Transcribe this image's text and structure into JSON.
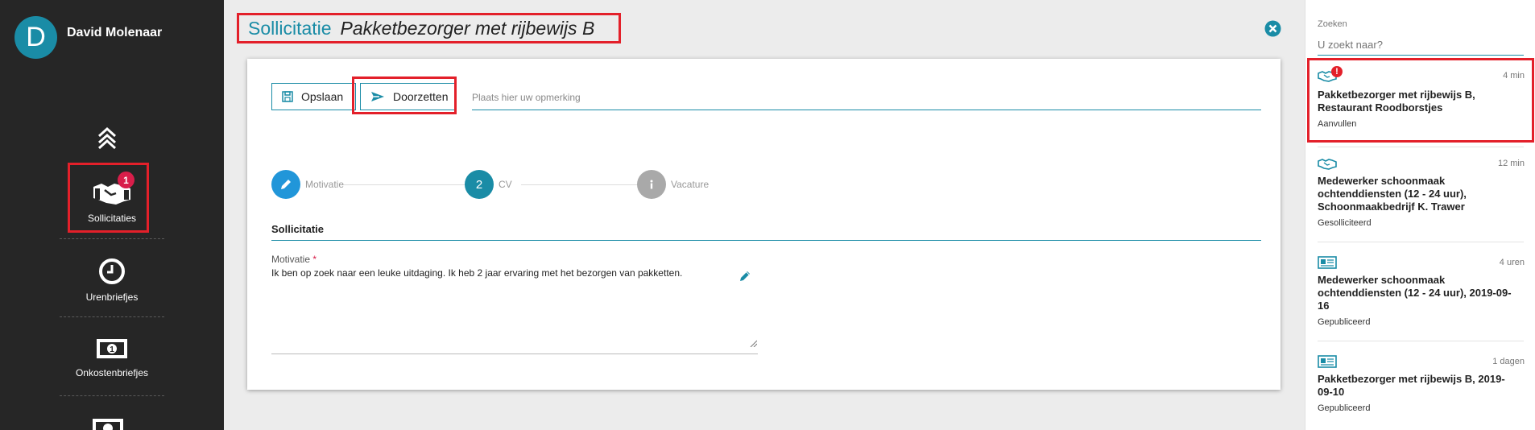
{
  "user": {
    "initial": "D",
    "name": "David Molenaar"
  },
  "nav": {
    "items": [
      {
        "label": "Sollicitaties",
        "badge": "1",
        "icon": "handshake-icon"
      },
      {
        "label": "Urenbriefjes",
        "icon": "clock-icon"
      },
      {
        "label": "Onkostenbriefjes",
        "icon": "money-icon"
      }
    ]
  },
  "header": {
    "title": "Sollicitatie",
    "subtitle": "Pakketbezorger met rijbewijs B"
  },
  "toolbar": {
    "save_label": "Opslaan",
    "forward_label": "Doorzetten",
    "remark_placeholder": "Plaats hier uw opmerking"
  },
  "steps": [
    {
      "label": "Motivatie",
      "icon": "pencil-icon"
    },
    {
      "label": "CV",
      "number": "2"
    },
    {
      "label": "Vacature",
      "icon": "info-icon"
    }
  ],
  "section": {
    "title": "Sollicitatie",
    "field_label": "Motivatie",
    "required_mark": "*",
    "motivation_text": "Ik ben op zoek naar een leuke uitdaging. Ik heb 2 jaar ervaring met het bezorgen van pakketten."
  },
  "search": {
    "label": "Zoeken",
    "placeholder": "U zoekt naar?"
  },
  "notifications": [
    {
      "icon": "handshake-icon",
      "alert": "!",
      "time": "4 min",
      "title": "Pakketbezorger met rijbewijs B, Restaurant Roodborstjes",
      "status": "Aanvullen"
    },
    {
      "icon": "handshake-icon",
      "time": "12 min",
      "title": "Medewerker schoonmaak ochtenddiensten (12 - 24 uur), Schoonmaakbedrijf K. Trawer",
      "status": "Gesolliciteerd"
    },
    {
      "icon": "newspaper-icon",
      "time": "4 uren",
      "title": "Medewerker schoonmaak ochtenddiensten (12 - 24 uur), 2019-09-16",
      "status": "Gepubliceerd"
    },
    {
      "icon": "newspaper-icon",
      "time": "1 dagen",
      "title": "Pakketbezorger met rijbewijs B, 2019-09-10",
      "status": "Gepubliceerd"
    }
  ],
  "colors": {
    "accent": "#1a8ca6",
    "highlight": "#e3202a",
    "badge": "#d81e4a",
    "sidebar": "#262626"
  }
}
